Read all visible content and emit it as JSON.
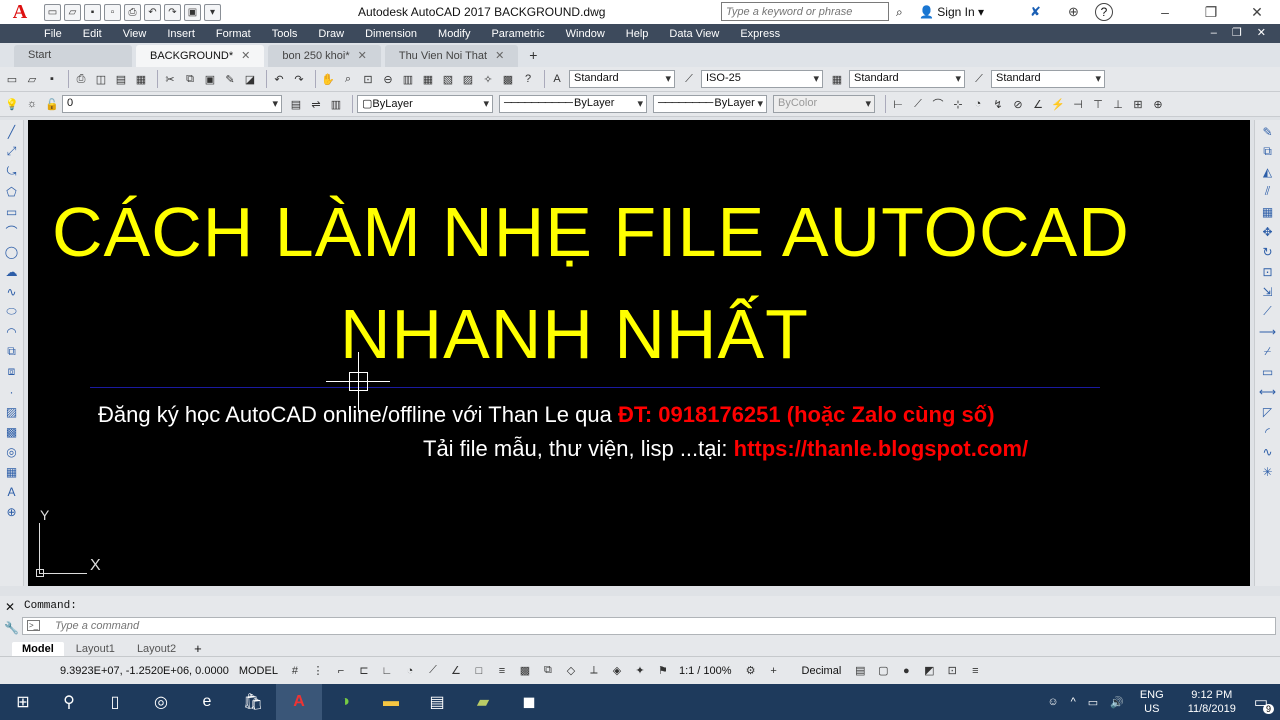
{
  "titlebar": {
    "app_logo": "A",
    "title": "Autodesk AutoCAD 2017    BACKGROUND.dwg",
    "search_placeholder": "Type a keyword or phrase",
    "sign_in": "Sign In",
    "help_icon": "?",
    "minimize_icon": "–",
    "restore_icon": "❐",
    "close_icon": "✕"
  },
  "menubar": {
    "items": [
      "File",
      "Edit",
      "View",
      "Insert",
      "Format",
      "Tools",
      "Draw",
      "Dimension",
      "Modify",
      "Parametric",
      "Window",
      "Help",
      "Data View",
      "Express"
    ],
    "window_controls": "– ❐ ✕"
  },
  "doc_tabs": [
    {
      "label": "Start",
      "close": ""
    },
    {
      "label": "BACKGROUND*",
      "close": "✕"
    },
    {
      "label": "bon 250 khoi*",
      "close": "✕"
    },
    {
      "label": "Thu Vien Noi That",
      "close": "✕"
    }
  ],
  "doc_tab_add": "+",
  "toolbar1": {
    "text_style": "Standard",
    "dim_style": "ISO-25",
    "table_style": "Standard",
    "multileader_style": "Standard"
  },
  "toolbar2": {
    "layer": "0",
    "color": "ByLayer",
    "linetype": "ByLayer",
    "lineweight": "ByLayer",
    "plot_style": "ByColor"
  },
  "canvas": {
    "headline_line1": "CÁCH LÀM NHẸ FILE AUTOCAD",
    "headline_line2": "NHANH NHẤT",
    "info1_text": "Đăng ký học AutoCAD online/offline với Than Le qua ",
    "info1_red": "ĐT: 0918176251 (hoặc Zalo cùng số)",
    "info2_text": "Tải file mẫu, thư viện, lisp ...tại:  ",
    "info2_red": "https://thanle.blogspot.com/",
    "ucs_y": "Y",
    "ucs_x": "X",
    "headline_color": "#ffff00",
    "highlight_color": "#ff0000"
  },
  "command": {
    "label": "Command:",
    "placeholder": "Type a command",
    "close_icon": "✕",
    "wrench_icon": "🔧"
  },
  "layout_tabs": [
    "Model",
    "Layout1",
    "Layout2"
  ],
  "layout_tab_add": "+",
  "statusbar": {
    "coords": "9.3923E+07, -1.2520E+06, 0.0000",
    "space": "MODEL",
    "scale": "1:1 / 100%",
    "units": "Decimal"
  },
  "taskbar": {
    "language_top": "ENG",
    "language_bottom": "US",
    "time": "9:12 PM",
    "date": "11/8/2019",
    "notification_count": "9"
  }
}
